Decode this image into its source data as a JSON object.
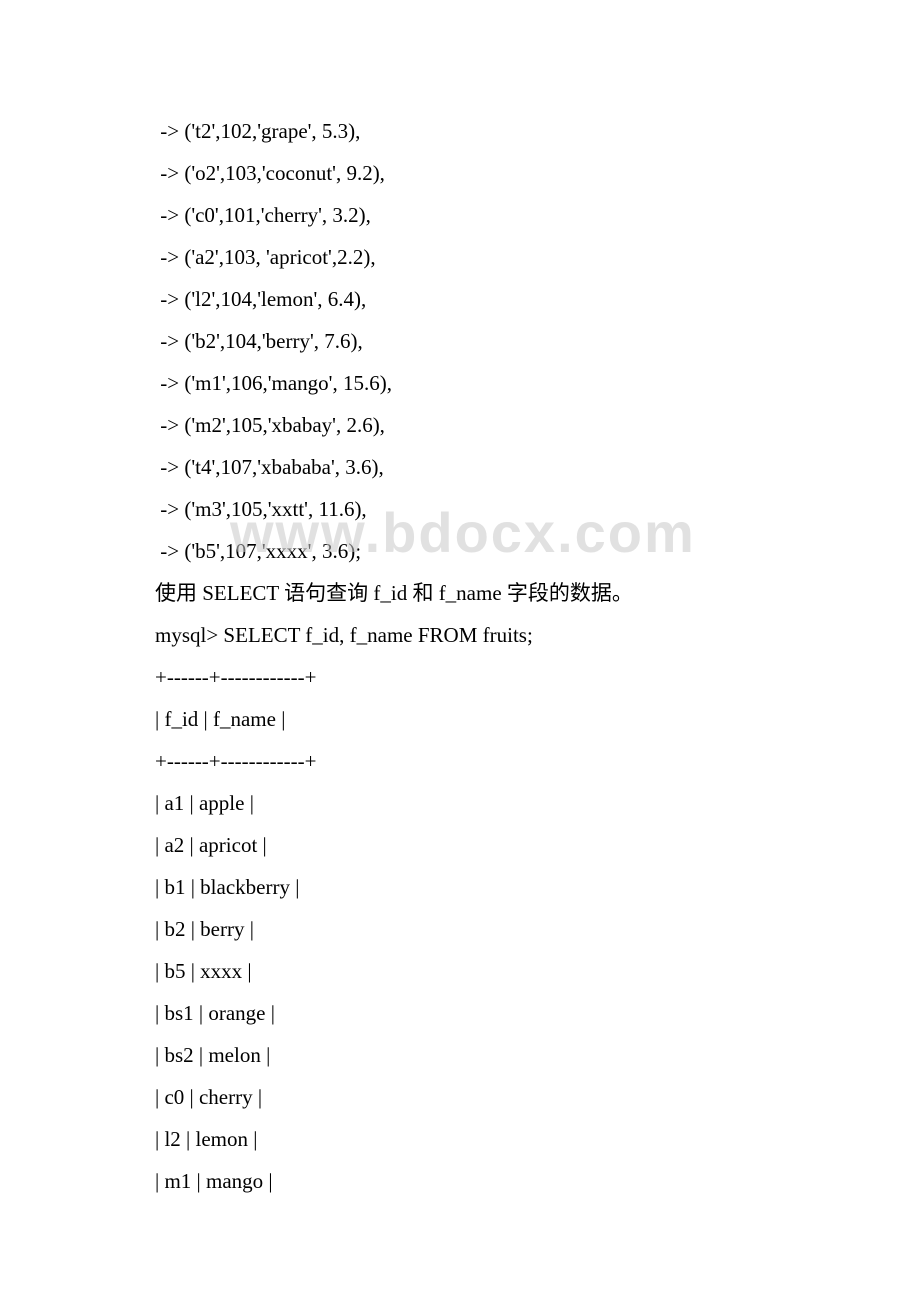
{
  "watermark": "www.bdocx.com",
  "lines": [
    " -> ('t2',102,'grape', 5.3),",
    " -> ('o2',103,'coconut', 9.2),",
    " -> ('c0',101,'cherry', 3.2),",
    " -> ('a2',103, 'apricot',2.2),",
    " -> ('l2',104,'lemon', 6.4),",
    " -> ('b2',104,'berry', 7.6),",
    " -> ('m1',106,'mango', 15.6),",
    " -> ('m2',105,'xbabay', 2.6),",
    " -> ('t4',107,'xbababa', 3.6),",
    " -> ('m3',105,'xxtt', 11.6),",
    " -> ('b5',107,'xxxx', 3.6);",
    "使用 SELECT 语句查询 f_id 和 f_name 字段的数据。",
    "mysql> SELECT f_id, f_name FROM fruits;",
    "+------+------------+",
    "| f_id | f_name |",
    "+------+------------+",
    "| a1 | apple |",
    "| a2 | apricot |",
    "| b1 | blackberry |",
    "| b2 | berry |",
    "| b5 | xxxx |",
    "| bs1 | orange |",
    "| bs2 | melon |",
    "| c0 | cherry |",
    "| l2 | lemon |",
    "| m1 | mango |"
  ]
}
